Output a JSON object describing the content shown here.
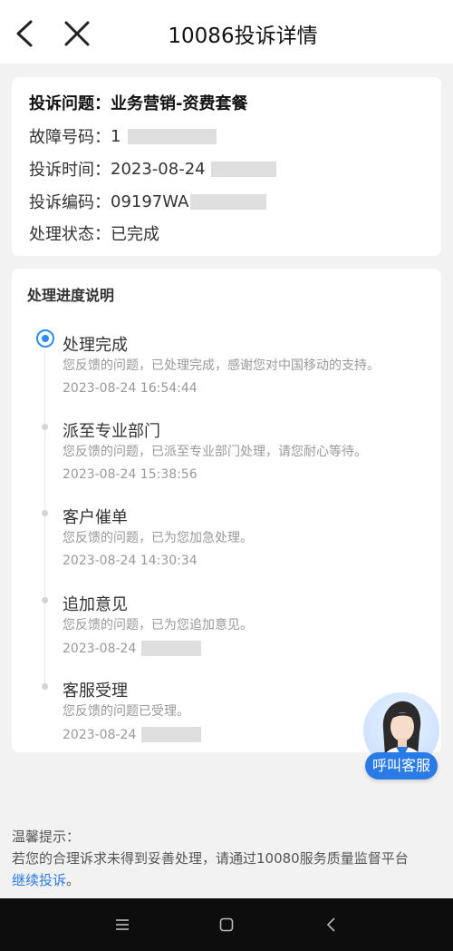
{
  "header": {
    "title": "10086投诉详情",
    "back_icon": "chevron-left-icon",
    "close_icon": "close-icon"
  },
  "info": {
    "issue_label": "投诉问题：",
    "issue_value": "业务营销-资费套餐",
    "phone_label": "故障号码：",
    "phone_value": "1",
    "time_label": "投诉时间：",
    "time_value": "2023-08-24",
    "code_label": "投诉编码：",
    "code_value": "09197WA",
    "status_label": "处理状态：",
    "status_value": "已完成"
  },
  "progress": {
    "title": "处理进度说明",
    "steps": [
      {
        "name": "处理完成",
        "desc": "您反馈的问题，已处理完成，感谢您对中国移动的支持。",
        "time": "2023-08-24 16:54:44",
        "active": true
      },
      {
        "name": "派至专业部门",
        "desc": "您反馈的问题，已派至专业部门处理，请您耐心等待。",
        "time": "2023-08-24 15:38:56",
        "active": false
      },
      {
        "name": "客户催单",
        "desc": "您反馈的问题，已为您加急处理。",
        "time": "2023-08-24 14:30:34",
        "active": false
      },
      {
        "name": "追加意见",
        "desc": "您反馈的问题，已为您追加意见。",
        "time": "2023-08-24",
        "active": false
      },
      {
        "name": "客服受理",
        "desc": "您反馈的问题已受理。",
        "time": "2023-08-24",
        "active": false
      }
    ]
  },
  "service": {
    "button_label": "呼叫客服"
  },
  "tips": {
    "heading": "温馨提示：",
    "text": "若您的合理诉求未得到妥善处理，请通过10080服务质量监督平台",
    "link": "继续投诉",
    "end": "。"
  },
  "colors": {
    "accent": "#2a7be6",
    "background": "#f2f2f2",
    "navbar": "#0d0d0d"
  }
}
